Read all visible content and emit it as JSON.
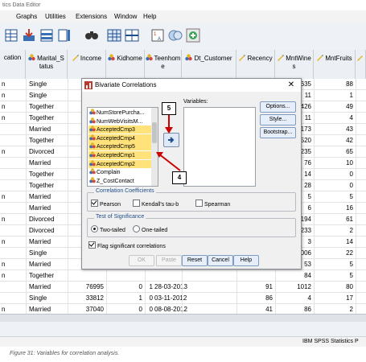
{
  "window": {
    "title": "tics Data Editor"
  },
  "menu": [
    "Graphs",
    "Utilities",
    "Extensions",
    "Window",
    "Help"
  ],
  "grid": {
    "headers": [
      {
        "label": "cation",
        "icon": "none"
      },
      {
        "label": "Marital_S\ntatus",
        "icon": "nominal-icon"
      },
      {
        "label": "Income",
        "icon": "scale-icon"
      },
      {
        "label": "Kidhome",
        "icon": "nominal-icon"
      },
      {
        "label": "Teenhom\ne",
        "icon": "nominal-icon"
      },
      {
        "label": "Dt_Customer",
        "icon": "nominal-icon"
      },
      {
        "label": "Recency",
        "icon": "scale-icon"
      },
      {
        "label": "MntWine\ns",
        "icon": "scale-icon"
      },
      {
        "label": "MntFruits",
        "icon": "scale-icon"
      }
    ],
    "rows": [
      {
        "c0": "n",
        "c1": "Single",
        "c2": "",
        "c3": "",
        "c4": "",
        "c5": "",
        "c6": "",
        "c7": "635",
        "c8": "88"
      },
      {
        "c0": "n",
        "c1": "Single",
        "c2": "",
        "c3": "",
        "c4": "",
        "c5": "",
        "c6": "",
        "c7": "11",
        "c8": "1"
      },
      {
        "c0": "n",
        "c1": "Together",
        "c2": "",
        "c3": "",
        "c4": "",
        "c5": "",
        "c6": "",
        "c7": "426",
        "c8": "49"
      },
      {
        "c0": "n",
        "c1": "Together",
        "c2": "",
        "c3": "",
        "c4": "",
        "c5": "",
        "c6": "",
        "c7": "11",
        "c8": "4"
      },
      {
        "c0": "",
        "c1": "Married",
        "c2": "",
        "c3": "",
        "c4": "",
        "c5": "",
        "c6": "",
        "c7": "173",
        "c8": "43"
      },
      {
        "c0": "",
        "c1": "Together",
        "c2": "",
        "c3": "",
        "c4": "",
        "c5": "",
        "c6": "",
        "c7": "520",
        "c8": "42"
      },
      {
        "c0": "n",
        "c1": "Divorced",
        "c2": "",
        "c3": "",
        "c4": "",
        "c5": "",
        "c6": "",
        "c7": "235",
        "c8": "65"
      },
      {
        "c0": "",
        "c1": "Married",
        "c2": "",
        "c3": "",
        "c4": "",
        "c5": "",
        "c6": "",
        "c7": "76",
        "c8": "10"
      },
      {
        "c0": "",
        "c1": "Together",
        "c2": "",
        "c3": "",
        "c4": "",
        "c5": "",
        "c6": "",
        "c7": "14",
        "c8": "0"
      },
      {
        "c0": "",
        "c1": "Together",
        "c2": "",
        "c3": "",
        "c4": "",
        "c5": "",
        "c6": "",
        "c7": "28",
        "c8": "0"
      },
      {
        "c0": "n",
        "c1": "Married",
        "c2": "",
        "c3": "",
        "c4": "",
        "c5": "",
        "c6": "",
        "c7": "5",
        "c8": "5"
      },
      {
        "c0": "",
        "c1": "Married",
        "c2": "",
        "c3": "",
        "c4": "",
        "c5": "",
        "c6": "",
        "c7": "6",
        "c8": "16"
      },
      {
        "c0": "n",
        "c1": "Divorced",
        "c2": "",
        "c3": "",
        "c4": "",
        "c5": "",
        "c6": "",
        "c7": "194",
        "c8": "61"
      },
      {
        "c0": "",
        "c1": "Divorced",
        "c2": "",
        "c3": "",
        "c4": "",
        "c5": "",
        "c6": "",
        "c7": "233",
        "c8": "2"
      },
      {
        "c0": "n",
        "c1": "Married",
        "c2": "",
        "c3": "",
        "c4": "",
        "c5": "",
        "c6": "",
        "c7": "3",
        "c8": "14"
      },
      {
        "c0": "",
        "c1": "Single",
        "c2": "",
        "c3": "",
        "c4": "",
        "c5": "",
        "c6": "",
        "c7": "006",
        "c8": "22"
      },
      {
        "c0": "n",
        "c1": "Married",
        "c2": "",
        "c3": "",
        "c4": "",
        "c5": "",
        "c6": "",
        "c7": "53",
        "c8": "5"
      },
      {
        "c0": "n",
        "c1": "Together",
        "c2": "",
        "c3": "",
        "c4": "",
        "c5": "",
        "c6": "",
        "c7": "84",
        "c8": "5"
      },
      {
        "c0": "",
        "c1": "Married",
        "c2": "76995",
        "c3": "0",
        "c4": "1",
        "c5": "28-03-2013",
        "c6": "91",
        "c7": "1012",
        "c8": "80"
      },
      {
        "c0": "",
        "c1": "Single",
        "c2": "33812",
        "c3": "1",
        "c4": "0",
        "c5": "03-11-2012",
        "c6": "86",
        "c7": "4",
        "c8": "17"
      },
      {
        "c0": "n",
        "c1": "Married",
        "c2": "37040",
        "c3": "0",
        "c4": "0",
        "c5": "08-08-2012",
        "c6": "41",
        "c7": "86",
        "c8": "2"
      }
    ]
  },
  "dialog": {
    "title": "Bivariate Correlations",
    "variables_label": "Variables:",
    "source_list": [
      {
        "name": "NumStorePurcha...",
        "selected": false
      },
      {
        "name": "NumWebVisitsM...",
        "selected": false
      },
      {
        "name": "AcceptedCmp3",
        "selected": true
      },
      {
        "name": "AcceptedCmp4",
        "selected": true
      },
      {
        "name": "AcceptedCmp5",
        "selected": true
      },
      {
        "name": "AcceptedCmp1",
        "selected": true
      },
      {
        "name": "AcceptedCmp2",
        "selected": true
      },
      {
        "name": "Complain",
        "selected": false
      },
      {
        "name": "Z_CostContact",
        "selected": false
      }
    ],
    "side_buttons": [
      "Options...",
      "Style...",
      "Bootstrap..."
    ],
    "coefficients": {
      "title": "Correlation Coefficients",
      "pearson": {
        "label": "Pearson",
        "checked": true
      },
      "kendall": {
        "label": "Kendall's tau-b",
        "checked": false
      },
      "spearman": {
        "label": "Spearman",
        "checked": false
      }
    },
    "significance": {
      "title": "Test of Significance",
      "two_tailed": {
        "label": "Two-tailed",
        "selected": true
      },
      "one_tailed": {
        "label": "One-tailed",
        "selected": false
      }
    },
    "flag": {
      "label": "Flag significant correlations",
      "checked": true
    },
    "buttons": {
      "ok": "OK",
      "paste": "Paste",
      "reset": "Reset",
      "cancel": "Cancel",
      "help": "Help"
    }
  },
  "callouts": {
    "step5": "5",
    "step4": "4"
  },
  "status": {
    "right": "IBM SPSS Statistics P"
  },
  "caption": "Figure 31: Variables for correlation analysis.",
  "colors": {
    "highlight": "#ffe27a",
    "annotation_arrow": "#cc0000",
    "arrow_button": "#dfe9f7",
    "group_title": "#1f4e8c"
  }
}
